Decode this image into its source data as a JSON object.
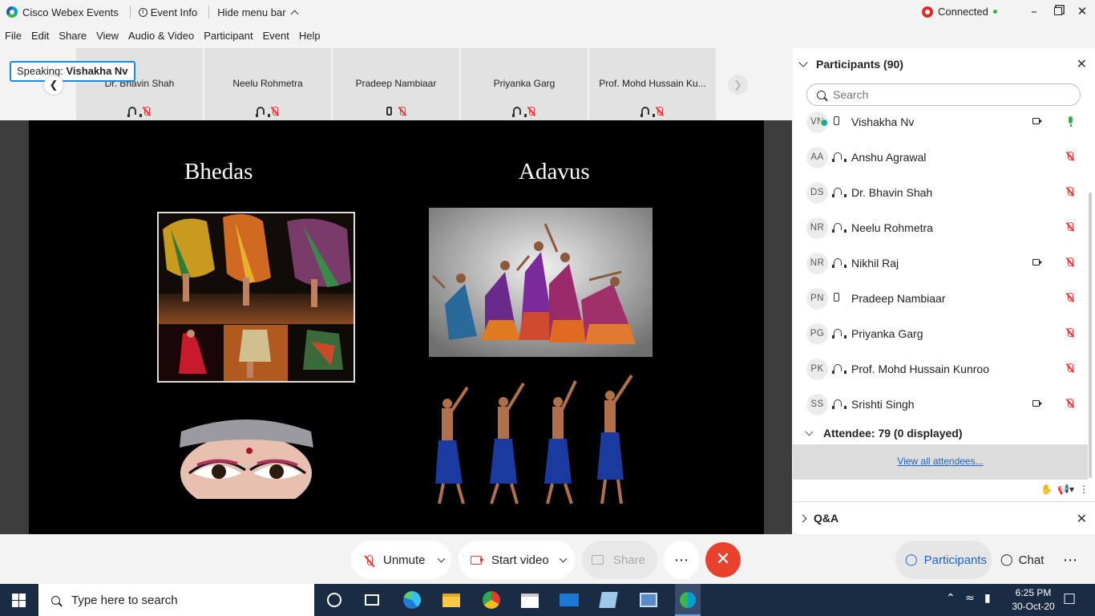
{
  "window": {
    "app_title": "Cisco Webex Events",
    "event_info": "Event Info",
    "hide_menu": "Hide menu bar",
    "status": "Connected"
  },
  "menu": [
    "File",
    "Edit",
    "Share",
    "View",
    "Audio & Video",
    "Participant",
    "Event",
    "Help"
  ],
  "speaking": {
    "label": "Speaking:",
    "name": "Vishakha Nv"
  },
  "thumbnails": [
    {
      "name": "Dr. Bhavin Shah",
      "device": "headset-icon"
    },
    {
      "name": "Neelu Rohmetra",
      "device": "headset-icon"
    },
    {
      "name": "Pradeep Nambiaar",
      "device": "phone-icon"
    },
    {
      "name": "Priyanka Garg",
      "device": "headset-icon"
    },
    {
      "name": "Prof. Mohd Hussain Ku..."
    }
  ],
  "slide": {
    "left_heading": "Bhedas",
    "right_heading": "Adavus"
  },
  "panel": {
    "title": "Participants (90)",
    "search_placeholder": "Search",
    "participants": [
      {
        "initials": "VN",
        "name": "Vishakha Nv",
        "device": "phone-icon",
        "video": true,
        "audio": "speaking"
      },
      {
        "initials": "AA",
        "name": "Anshu Agrawal",
        "device": "headset-icon",
        "video": false,
        "audio": "muted"
      },
      {
        "initials": "DS",
        "name": "Dr. Bhavin Shah",
        "device": "headset-icon",
        "video": false,
        "audio": "muted"
      },
      {
        "initials": "NR",
        "name": "Neelu Rohmetra",
        "device": "headset-icon",
        "video": false,
        "audio": "muted"
      },
      {
        "initials": "NR",
        "name": "Nikhil Raj",
        "device": "headset-icon",
        "video": true,
        "audio": "muted"
      },
      {
        "initials": "PN",
        "name": "Pradeep Nambiaar",
        "device": "phone-icon",
        "video": false,
        "audio": "muted"
      },
      {
        "initials": "PG",
        "name": "Priyanka Garg",
        "device": "headset-icon",
        "video": false,
        "audio": "muted"
      },
      {
        "initials": "PK",
        "name": "Prof. Mohd Hussain Kunroo",
        "device": "headset-icon",
        "video": false,
        "audio": "muted"
      },
      {
        "initials": "SS",
        "name": "Srishti Singh",
        "device": "headset-icon",
        "video": true,
        "audio": "muted"
      }
    ],
    "attendee_header": "Attendee: 79 (0 displayed)",
    "view_all": "View all attendees...",
    "qa_title": "Q&A"
  },
  "controls": {
    "unmute": "Unmute",
    "start_video": "Start video",
    "share": "Share",
    "participants": "Participants",
    "chat": "Chat"
  },
  "taskbar": {
    "search_placeholder": "Type here to search",
    "time": "6:25 PM",
    "date": "30-Oct-20"
  },
  "colors": {
    "accent": "#1a8be0",
    "end_call": "#e8412c",
    "muted": "#ee3333",
    "speaking_mic": "#2ab54a",
    "taskbar": "#1a2b44"
  }
}
